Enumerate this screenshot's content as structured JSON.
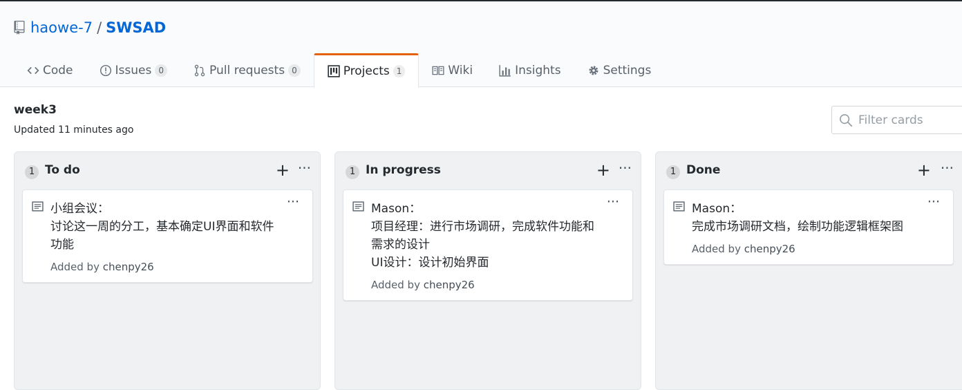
{
  "repo": {
    "owner": "haowe-7",
    "separator": "/",
    "name": "SWSAD"
  },
  "tabs": [
    {
      "label": "Code",
      "icon": "code-icon"
    },
    {
      "label": "Issues",
      "icon": "issue-icon",
      "count": "0"
    },
    {
      "label": "Pull requests",
      "icon": "pull-request-icon",
      "count": "0"
    },
    {
      "label": "Projects",
      "icon": "project-icon",
      "count": "1",
      "selected": true
    },
    {
      "label": "Wiki",
      "icon": "book-icon"
    },
    {
      "label": "Insights",
      "icon": "graph-icon"
    },
    {
      "label": "Settings",
      "icon": "gear-icon"
    }
  ],
  "board": {
    "name": "week3",
    "updated": "Updated 11 minutes ago"
  },
  "filter": {
    "placeholder": "Filter cards"
  },
  "columns": [
    {
      "count": "1",
      "name": "To do",
      "add": "+",
      "more": "···",
      "card": {
        "lines": [
          "小组会议：",
          "讨论这一周的分工，基本确定UI界面和软件",
          "功能"
        ],
        "added_by": "Added by",
        "user": "chenpy26",
        "more": "···"
      }
    },
    {
      "count": "1",
      "name": "In progress",
      "add": "+",
      "more": "···",
      "card": {
        "lines": [
          "Mason：",
          "项目经理：进行市场调研，完成软件功能和",
          "需求的设计",
          "UI设计：设计初始界面"
        ],
        "added_by": "Added by",
        "user": "chenpy26",
        "more": "···"
      }
    },
    {
      "count": "1",
      "name": "Done",
      "add": "+",
      "more": "···",
      "card": {
        "lines": [
          "Mason：",
          "完成市场调研文档，绘制功能逻辑框架图"
        ],
        "added_by": "Added by",
        "user": "chenpy26",
        "more": "···"
      }
    }
  ],
  "colors": {
    "link": "#0366d6",
    "selected_tab_accent": "#e36209",
    "column_bg": "#eff1f3"
  }
}
